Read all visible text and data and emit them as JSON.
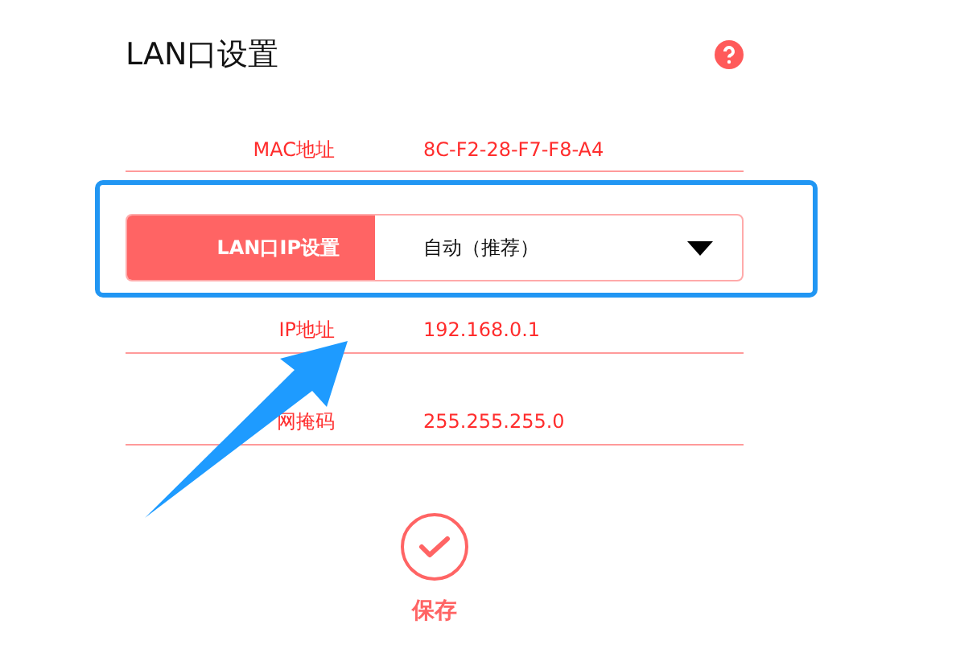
{
  "title": "LAN口设置",
  "mac": {
    "label": "MAC地址",
    "value": "8C-F2-28-F7-F8-A4"
  },
  "ip_mode": {
    "label": "LAN口IP设置",
    "value": "自动（推荐）",
    "highlighted": true
  },
  "rows": [
    {
      "label": "IP地址",
      "value": "192.168.0.1"
    },
    {
      "label": "网掩码",
      "value": "255.255.255.0"
    }
  ],
  "save": {
    "label": "保存"
  }
}
